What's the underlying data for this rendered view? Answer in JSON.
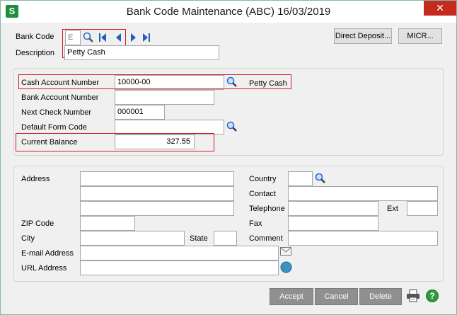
{
  "window": {
    "title": "Bank Code Maintenance (ABC) 16/03/2019",
    "app_icon_letter": "S",
    "close_glyph": "✕"
  },
  "header": {
    "bank_code_label": "Bank Code",
    "bank_code_value": "E",
    "description_label": "Description",
    "description_value": "Petty Cash",
    "direct_deposit_label": "Direct Deposit...",
    "micr_label": "MICR..."
  },
  "account": {
    "cash_account_label": "Cash Account Number",
    "cash_account_value": "10000-00",
    "cash_account_desc": "Petty Cash",
    "bank_account_label": "Bank Account Number",
    "bank_account_value": "",
    "next_check_label": "Next Check Number",
    "next_check_value": "000001",
    "default_form_label": "Default Form Code",
    "default_form_value": "",
    "current_balance_label": "Current Balance",
    "current_balance_value": "327.55"
  },
  "address": {
    "address_label": "Address",
    "address_line1": "",
    "address_line2": "",
    "address_line3": "",
    "zip_label": "ZIP Code",
    "zip_value": "",
    "city_label": "City",
    "city_value": "",
    "state_label": "State",
    "state_value": "",
    "email_label": "E-mail Address",
    "email_value": "",
    "url_label": "URL Address",
    "url_value": "",
    "country_label": "Country",
    "country_value": "",
    "contact_label": "Contact",
    "contact_value": "",
    "telephone_label": "Telephone",
    "telephone_value": "",
    "ext_label": "Ext",
    "ext_value": "",
    "fax_label": "Fax",
    "fax_value": "",
    "comment_label": "Comment",
    "comment_value": ""
  },
  "footer": {
    "accept_label": "Accept",
    "cancel_label": "Cancel",
    "delete_label": "Delete",
    "help_glyph": "?"
  }
}
